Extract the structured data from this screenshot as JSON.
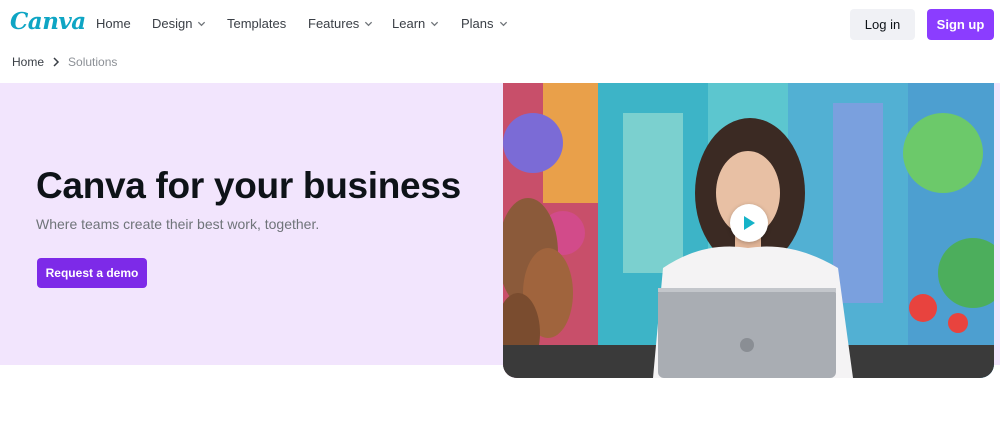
{
  "header": {
    "logo_text": "Canva",
    "nav": [
      {
        "label": "Home",
        "has_dropdown": false
      },
      {
        "label": "Design",
        "has_dropdown": true
      },
      {
        "label": "Templates",
        "has_dropdown": false
      },
      {
        "label": "Features",
        "has_dropdown": true
      },
      {
        "label": "Learn",
        "has_dropdown": true
      },
      {
        "label": "Plans",
        "has_dropdown": true
      }
    ],
    "login_label": "Log in",
    "signup_label": "Sign up"
  },
  "breadcrumb": {
    "home": "Home",
    "current": "Solutions"
  },
  "hero": {
    "title": "Canva for your business",
    "subtitle": "Where teams create their best work, together.",
    "cta_label": "Request a demo"
  },
  "video": {
    "icon": "play-icon"
  },
  "colors": {
    "brand_purple": "#8b3dff",
    "cta_purple": "#7d2ae8",
    "hero_bg": "#f2e5fd",
    "logo_teal": "#0ea5c4",
    "play_teal": "#15b3c8"
  }
}
